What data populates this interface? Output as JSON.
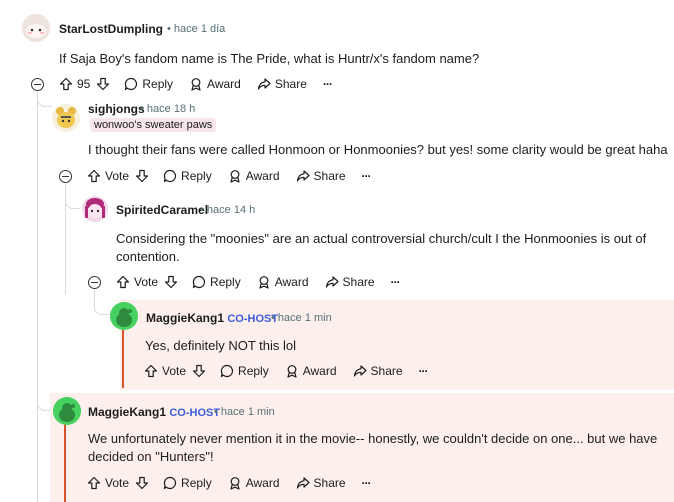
{
  "comments": [
    {
      "username": "StarLostDumpling",
      "time": "hace 1 día",
      "text": "If Saja Boy's fandom name is The Pride, what is Huntr/x's fandom name?",
      "votes": "95",
      "reply": "Reply",
      "award": "Award",
      "share": "Share"
    },
    {
      "username": "sighjongs",
      "time": "hace 18 h",
      "flair": "wonwoo's sweater paws",
      "text": "I thought their fans were called Honmoon or Honmoonies? but yes! some clarity would be great haha",
      "votes": "Vote",
      "reply": "Reply",
      "award": "Award",
      "share": "Share"
    },
    {
      "username": "SpiritedCaramel",
      "time": "hace 14 h",
      "text": "Considering the \"moonies\" are an actual controversial church/cult I the Honmoonies is out of contention.",
      "votes": "Vote",
      "reply": "Reply",
      "award": "Award",
      "share": "Share"
    },
    {
      "username": "MaggieKang1",
      "badge": "CO-HOST",
      "time": "hace 1 min",
      "text": "Yes, definitely NOT this lol",
      "votes": "Vote",
      "reply": "Reply",
      "award": "Award",
      "share": "Share"
    },
    {
      "username": "MaggieKang1",
      "badge": "CO-HOST",
      "time": "hace 1 min",
      "text": "We unfortunately never mention it in the movie-- honestly, we couldn't decide on one... but we have decided on \"Hunters\"!",
      "votes": "Vote",
      "reply": "Reply",
      "award": "Award",
      "share": "Share"
    }
  ],
  "separator": "•",
  "more": "···",
  "colors": {
    "highlight_bg": "#fdf0ec",
    "highlight_bar": "#d9532b",
    "cohost": "#3b5bdb",
    "meta": "#576f76"
  }
}
